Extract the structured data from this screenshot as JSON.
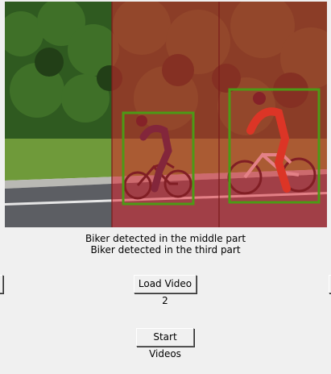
{
  "status": {
    "line1": "Biker detected in the middle part",
    "line2": "Biker detected in the third part"
  },
  "buttons": {
    "load_video_2": "Load Video 2",
    "start_videos": "Start Videos"
  },
  "colors": {
    "overlay": "#e0232e",
    "detection_box": "#4c9a16",
    "background": "#f0f0f0"
  }
}
